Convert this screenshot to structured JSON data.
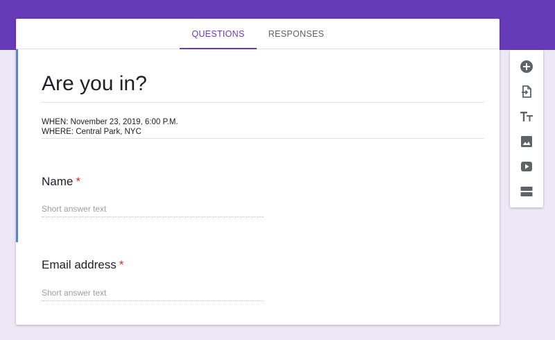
{
  "tabs": {
    "questions_label": "QUESTIONS",
    "responses_label": "RESPONSES",
    "active": "QUESTIONS"
  },
  "form": {
    "title": "Are you in?",
    "description_line1": "WHEN: November 23, 2019, 6:00 P.M.",
    "description_line2": "WHERE: Central Park, NYC"
  },
  "questions": [
    {
      "label": "Name",
      "required_mark": "*",
      "placeholder": "Short answer text"
    },
    {
      "label": "Email address",
      "required_mark": "*",
      "placeholder": "Short answer text"
    }
  ],
  "toolbar": {
    "items": [
      {
        "icon": "add-circle-icon"
      },
      {
        "icon": "import-questions-icon"
      },
      {
        "icon": "title-text-icon"
      },
      {
        "icon": "image-icon"
      },
      {
        "icon": "video-icon"
      },
      {
        "icon": "section-icon"
      }
    ]
  },
  "colors": {
    "brand": "#673ab7",
    "background": "#ede7f6",
    "accent_bar": "#4285f4",
    "required": "#d93025",
    "icon": "#5f6368"
  }
}
